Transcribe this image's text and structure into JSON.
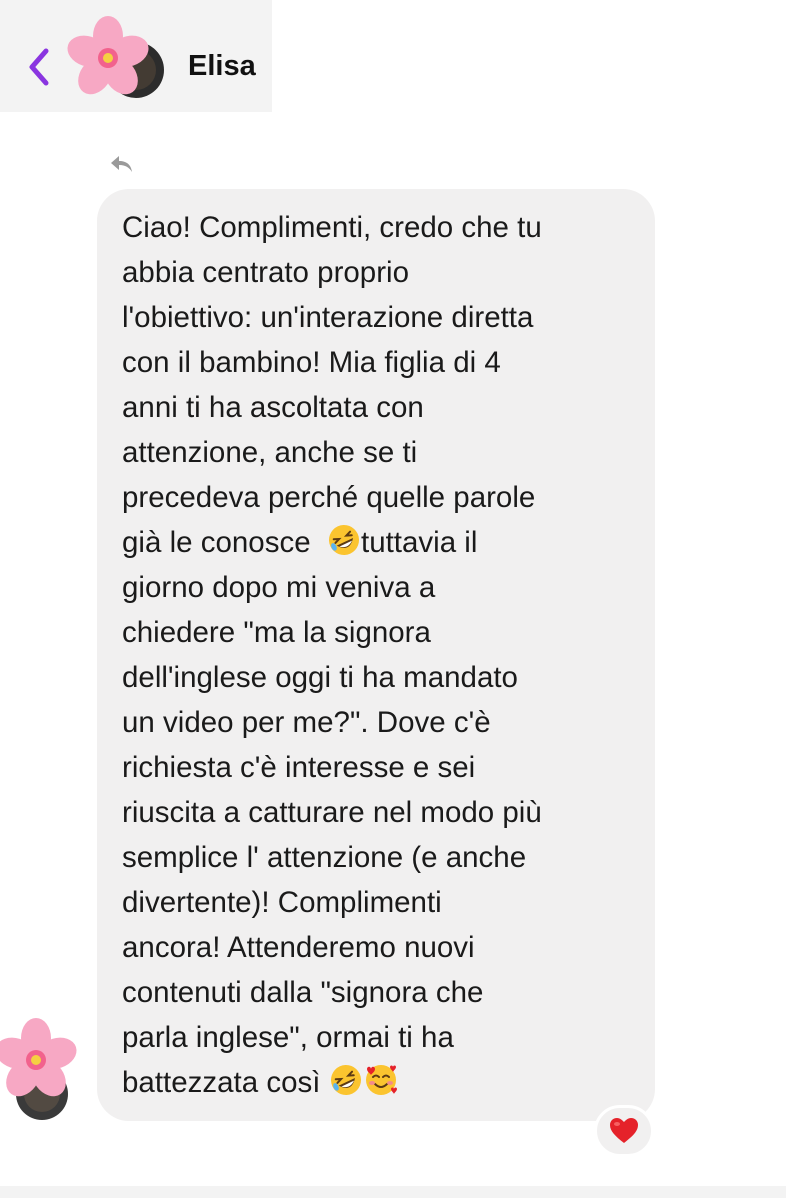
{
  "header": {
    "contact_name": "Elisa",
    "back_icon": "chevron-left-icon",
    "avatar_icon": "cherry-blossom-icon",
    "accent_color": "#8a35e0"
  },
  "message": {
    "reply_icon": "reply-arrow-icon",
    "lines": [
      "Ciao! Complimenti, credo che tu",
      "abbia centrato proprio",
      "l'obiettivo: un'interazione diretta",
      "con il bambino! Mia figlia di 4",
      "anni ti ha ascoltata con",
      "attenzione, anche se ti",
      "precedeva perché quelle parole",
      "già le conosce  ",
      "tuttavia il",
      "giorno dopo mi veniva a",
      "chiedere \"ma la signora",
      "dell'inglese oggi ti ha mandato",
      "un video per me?\". Dove c'è",
      "richiesta c'è interesse e sei",
      "riuscita a catturare nel modo più",
      "semplice l' attenzione (e anche",
      "divertente)! Complimenti",
      "ancora! Attenderemo nuovi",
      "contenuti dalla \"signora che",
      "parla inglese\", ormai ti ha",
      "battezzata così "
    ],
    "emojis": [
      "rolling-on-floor-laughing-icon",
      "smiling-face-with-hearts-icon"
    ],
    "bubble_color": "#f1f0f0"
  },
  "reaction": {
    "icon": "red-heart-icon",
    "color": "#e5222a"
  }
}
